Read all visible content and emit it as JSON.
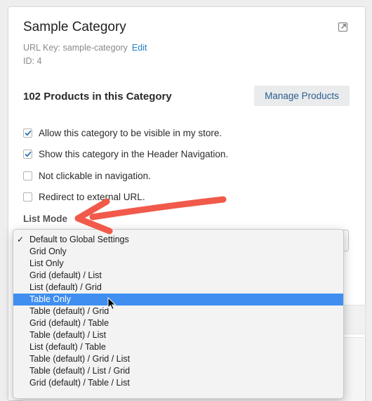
{
  "category": {
    "title": "Sample Category",
    "url_key_label": "URL Key: sample-category",
    "edit_label": "Edit",
    "id_label": "ID: 4"
  },
  "products": {
    "heading": "102 Products in this Category",
    "manage_label": "Manage Products"
  },
  "options": [
    {
      "label": "Allow this category to be visible in my store.",
      "checked": true
    },
    {
      "label": "Show this category in the Header Navigation.",
      "checked": true
    },
    {
      "label": "Not clickable in navigation.",
      "checked": false
    },
    {
      "label": "Redirect to external URL.",
      "checked": false
    }
  ],
  "list_mode": {
    "label": "List Mode",
    "selected_value": "Table Only",
    "options": [
      "Default to Global Settings",
      "Grid Only",
      "List Only",
      "Grid (default) / List",
      "List (default) / Grid",
      "Table Only",
      "Table (default) / Grid",
      "Grid (default) / Table",
      "Table (default) / List",
      "List (default) / Table",
      "Table (default) / Grid / List",
      "Table (default) / List / Grid",
      "Grid (default) / Table / List"
    ],
    "checked_option": "Default to Global Settings",
    "highlighted_option": "Table Only"
  },
  "colors": {
    "accent": "#3f8ef0",
    "link": "#1f7ec7",
    "annotation_arrow": "#f15a4a",
    "checkbox_check": "#2a6fb5"
  },
  "icons": {
    "external": "external-link-icon",
    "check": "checkmark-icon",
    "arrow": "annotation-arrow-icon",
    "cursor": "mouse-pointer-icon"
  }
}
